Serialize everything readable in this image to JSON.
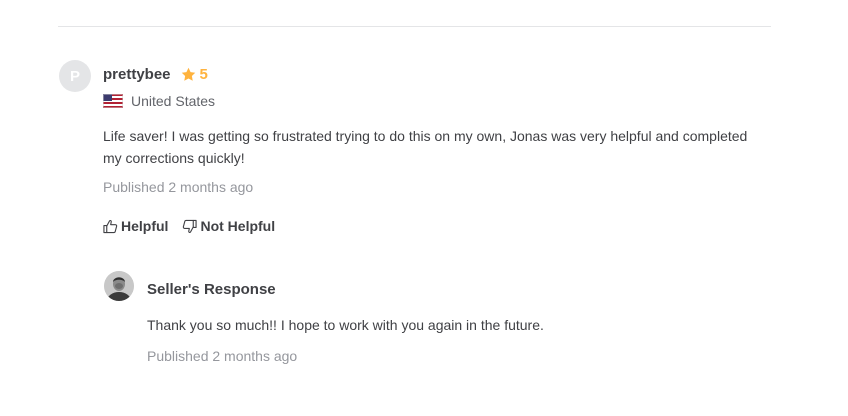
{
  "review": {
    "avatar_initial": "P",
    "username": "prettybee",
    "rating": "5",
    "country": "United States",
    "country_flag_icon": "us-flag-icon",
    "text": "Life saver! I was getting so frustrated trying to do this on my own, Jonas was very helpful and completed my corrections quickly!",
    "published": "Published 2 months ago",
    "helpful_label": "Helpful",
    "not_helpful_label": "Not Helpful"
  },
  "seller_response": {
    "title": "Seller's Response",
    "text": "Thank you so much!! I hope to work with you again in the future.",
    "published": "Published 2 months ago"
  },
  "colors": {
    "star": "#ffb33e",
    "text_primary": "#404145",
    "text_secondary": "#62646a",
    "text_muted": "#95979d",
    "divider": "#e4e5e7",
    "avatar_bg": "#e4e5e7"
  }
}
